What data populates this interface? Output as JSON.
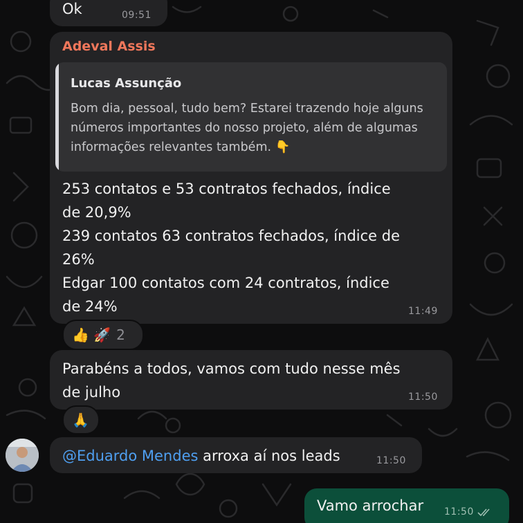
{
  "messages": {
    "ok": {
      "text": "Ok",
      "time": "09:51"
    },
    "adeval": {
      "sender": "Adeval Assis",
      "quote": {
        "author": "Lucas Assunção",
        "text": "Bom dia, pessoal, tudo bem? Estarei trazendo hoje alguns números importantes do nosso projeto, além de algumas informações relevantes também. 👇"
      },
      "text": "253 contatos e 53 contratos fechados, índice\nde 20,9%\n239 contatos 63 contratos fechados, índice de\n26%\nEdgar 100 contatos com 24 contratos, índice\nde 24%",
      "time": "11:49",
      "reactions": {
        "emojis": "👍 🚀",
        "count": "2"
      }
    },
    "parabens": {
      "text": "Parabéns a todos, vamos com tudo nesse mês\nde julho",
      "time": "11:50",
      "reactions": {
        "emojis": "🙏"
      }
    },
    "eduardo": {
      "mention": "@Eduardo Mendes",
      "text": " arroxa aí nos leads",
      "time": "11:50"
    },
    "outgoing": {
      "text": "Vamo arrochar",
      "time": "11:50"
    }
  },
  "colors": {
    "incoming_bubble": "#232325",
    "outgoing_bubble": "#0c4f3a",
    "sender_name": "#f0775b",
    "mention": "#4f9ff0"
  }
}
